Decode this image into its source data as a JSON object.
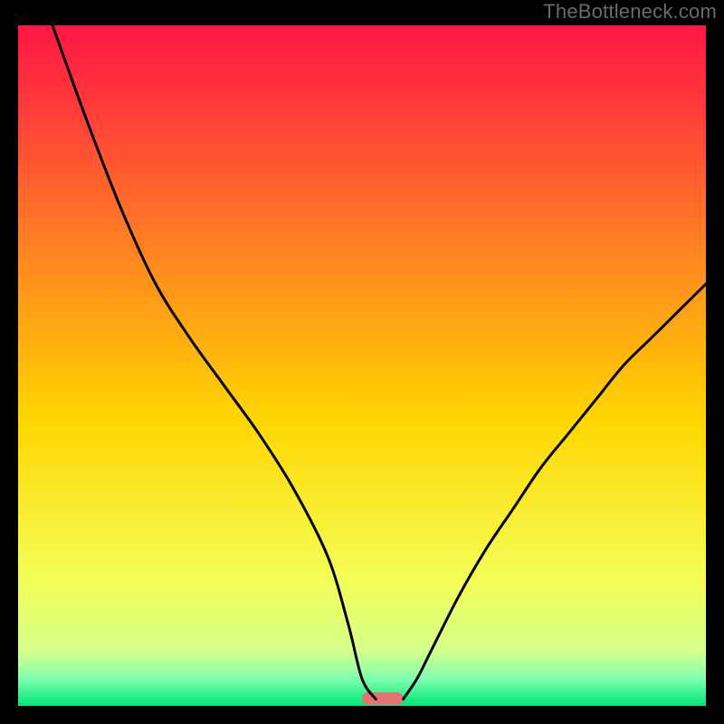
{
  "watermark": "TheBottleneck.com",
  "chart_data": {
    "type": "line",
    "title": "",
    "xlabel": "",
    "ylabel": "",
    "xlim": [
      0,
      100
    ],
    "ylim": [
      0,
      100
    ],
    "background_gradient": {
      "top": "#ff1744",
      "mid": "#ffd600",
      "bottom": "#00e676"
    },
    "series": [
      {
        "name": "left-curve",
        "x": [
          5,
          10,
          15,
          20,
          25,
          30,
          35,
          40,
          45,
          48,
          50,
          52
        ],
        "values": [
          100,
          86,
          73,
          62,
          54,
          47,
          40,
          32,
          22,
          12,
          4,
          1
        ]
      },
      {
        "name": "right-curve",
        "x": [
          56,
          58,
          60,
          64,
          68,
          72,
          76,
          80,
          84,
          88,
          92,
          96,
          100
        ],
        "values": [
          1,
          4,
          8,
          16,
          23,
          29,
          35,
          40,
          45,
          50,
          54,
          58,
          62
        ]
      }
    ],
    "marker": {
      "name": "optimal-marker",
      "x": 53,
      "y": 0,
      "width_pct": 6,
      "color": "#e57373"
    }
  }
}
